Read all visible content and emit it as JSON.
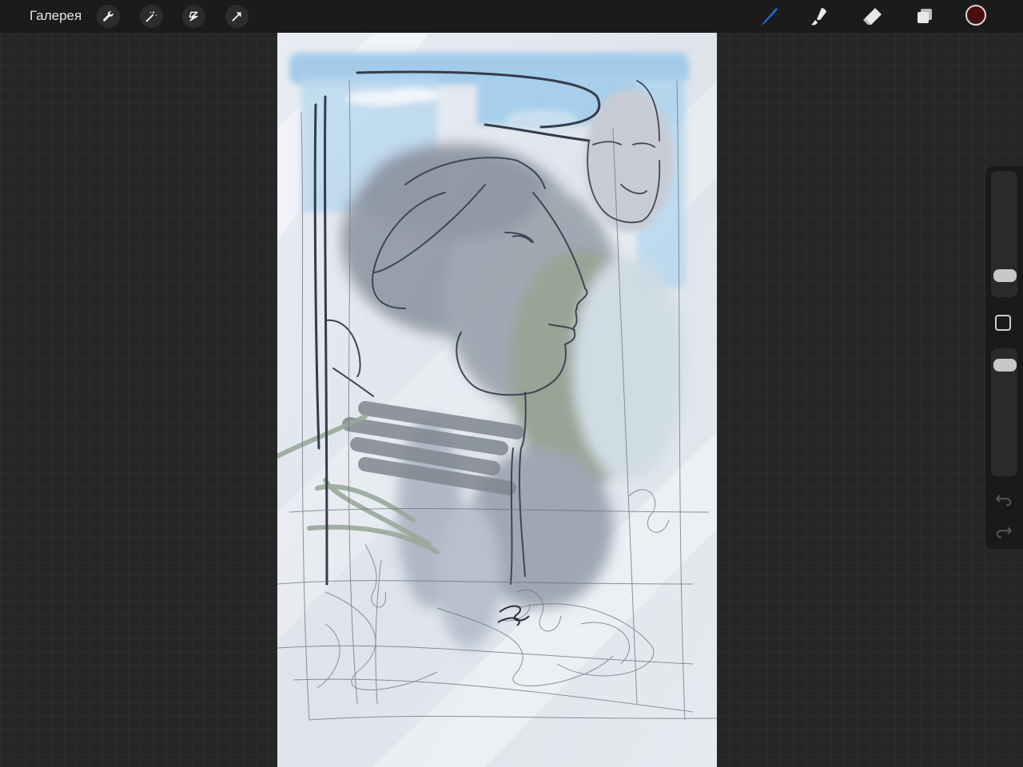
{
  "app": {
    "gallery_label": "Галерея"
  },
  "toolbar_left": [
    {
      "icon": "wrench-icon",
      "name": "actions"
    },
    {
      "icon": "magic-wand-icon",
      "name": "adjustments"
    },
    {
      "icon": "selection-icon",
      "name": "selection"
    },
    {
      "icon": "transform-arrow-icon",
      "name": "transform"
    }
  ],
  "toolbar_right": {
    "brush_icon": "brush-icon",
    "smudge_icon": "smudge-icon",
    "eraser_icon": "eraser-icon",
    "layers_icon": "layers-icon",
    "active_color": "#4a0f0f",
    "brush_active_color": "#1e6cd8"
  },
  "sidebar": {
    "brush_size": 0.12,
    "brush_opacity": 0.93,
    "modify_icon": "square-icon",
    "undo_icon": "undo-icon",
    "redo_icon": "redo-icon"
  },
  "canvas": {
    "content": "sketch-artwork"
  }
}
